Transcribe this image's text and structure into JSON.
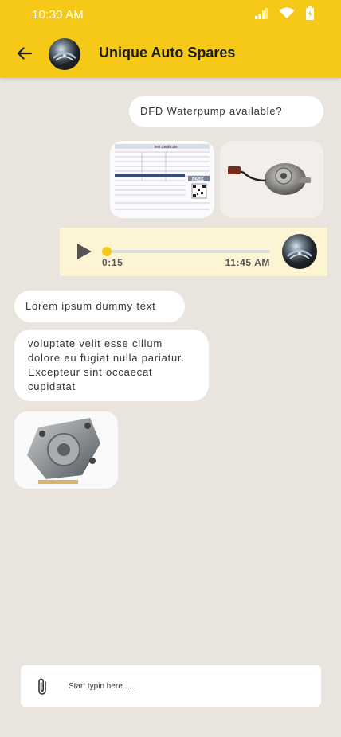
{
  "status_bar": {
    "time": "10:30 AM"
  },
  "header": {
    "contact_name": "Unique Auto Spares"
  },
  "messages": [
    {
      "type": "text",
      "side": "out",
      "text": "DFD Waterpump available?"
    },
    {
      "type": "images",
      "side": "out",
      "images": [
        {
          "title": "Test Certificate",
          "stamp": "PASS",
          "icon": "document-certificate-icon"
        },
        {
          "icon": "water-pump-part-icon"
        }
      ]
    },
    {
      "type": "audio",
      "side": "out",
      "elapsed": "0:15",
      "time": "11:45 AM",
      "progress": 0.0
    },
    {
      "type": "text",
      "side": "in",
      "text": "Lorem ipsum dummy text"
    },
    {
      "type": "text",
      "side": "in",
      "text": "voluptate velit esse cillum dolore eu fugiat nulla pariatur. Excepteur sint occaecat cupidatat"
    },
    {
      "type": "image",
      "side": "in",
      "icon": "water-pump-part-icon"
    }
  ],
  "composer": {
    "placeholder": "Start typin here......"
  },
  "colors": {
    "accent": "#f6c818",
    "background": "#e9e5de",
    "audio_bubble": "#fdf4d4"
  }
}
